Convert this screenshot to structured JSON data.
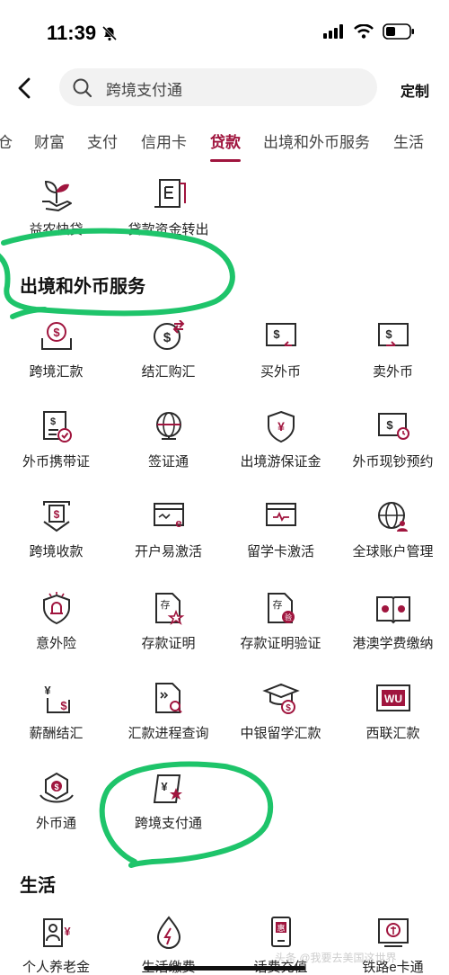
{
  "status_bar": {
    "time": "11:39"
  },
  "search": {
    "query": "跨境支付通",
    "customize_label": "定制"
  },
  "tabs": [
    {
      "label": "仓"
    },
    {
      "label": "财富"
    },
    {
      "label": "支付"
    },
    {
      "label": "信用卡"
    },
    {
      "label": "贷款",
      "active": true
    },
    {
      "label": "出境和外币服务"
    },
    {
      "label": "生活"
    }
  ],
  "loan_items": [
    {
      "label": "益农快贷",
      "icon": "sprout-icon"
    },
    {
      "label": "贷款资金转出",
      "icon": "transfer-document-icon"
    }
  ],
  "cross_border": {
    "title": "出境和外币服务",
    "items": [
      {
        "label": "跨境汇款",
        "icon": "remittance-icon"
      },
      {
        "label": "结汇购汇",
        "icon": "exchange-icon"
      },
      {
        "label": "买外币",
        "icon": "buy-currency-icon"
      },
      {
        "label": "卖外币",
        "icon": "sell-currency-icon"
      },
      {
        "label": "外币携带证",
        "icon": "carry-certificate-icon"
      },
      {
        "label": "签证通",
        "icon": "globe-icon"
      },
      {
        "label": "出境游保证金",
        "icon": "shield-yuan-icon"
      },
      {
        "label": "外币现钞预约",
        "icon": "cash-appointment-icon"
      },
      {
        "label": "跨境收款",
        "icon": "receive-icon"
      },
      {
        "label": "开户易激活",
        "icon": "card-activate-icon"
      },
      {
        "label": "留学卡激活",
        "icon": "study-card-icon"
      },
      {
        "label": "全球账户管理",
        "icon": "global-account-icon"
      },
      {
        "label": "意外险",
        "icon": "insurance-icon"
      },
      {
        "label": "存款证明",
        "icon": "deposit-certificate-icon"
      },
      {
        "label": "存款证明验证",
        "icon": "verify-certificate-icon"
      },
      {
        "label": "港澳学费缴纳",
        "icon": "tuition-book-icon"
      },
      {
        "label": "薪酬结汇",
        "icon": "salary-icon"
      },
      {
        "label": "汇款进程查询",
        "icon": "remittance-query-icon"
      },
      {
        "label": "中银留学汇款",
        "icon": "graduation-icon"
      },
      {
        "label": "西联汇款",
        "icon": "western-union-icon"
      },
      {
        "label": "外币通",
        "icon": "foreign-currency-icon"
      },
      {
        "label": "跨境支付通",
        "icon": "cross-border-pay-icon"
      }
    ]
  },
  "life": {
    "title": "生活",
    "items": [
      {
        "label": "个人养老金",
        "icon": "pension-icon"
      },
      {
        "label": "生活缴费",
        "icon": "utility-icon"
      },
      {
        "label": "话费充值",
        "icon": "phone-topup-icon"
      },
      {
        "label": "铁路e卡通",
        "icon": "railway-icon"
      }
    ]
  },
  "western_union_badge": "WU",
  "watermark": "头条 @我要去美国这世界",
  "colors": {
    "accent": "#a0153e",
    "highlight": "#1ec46a",
    "icon": "#2a2a2a"
  }
}
